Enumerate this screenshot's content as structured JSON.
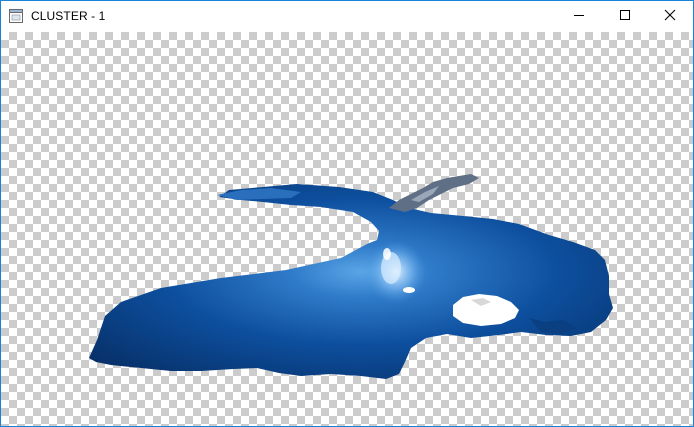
{
  "window": {
    "title": "CLUSTER - 1",
    "border_color": "#1883d7"
  },
  "titlebar": {
    "icons": {
      "app": "window-app-icon",
      "minimize": "minimize-icon",
      "maximize": "maximize-icon",
      "close": "close-icon"
    }
  },
  "canvas": {
    "background": "transparency-checkerboard",
    "content": "segmented-water-cluster",
    "colors": {
      "deep": "#07316b",
      "mid": "#0c4fa0",
      "light": "#4f9be0",
      "highlight": "#cfe6ff"
    }
  }
}
